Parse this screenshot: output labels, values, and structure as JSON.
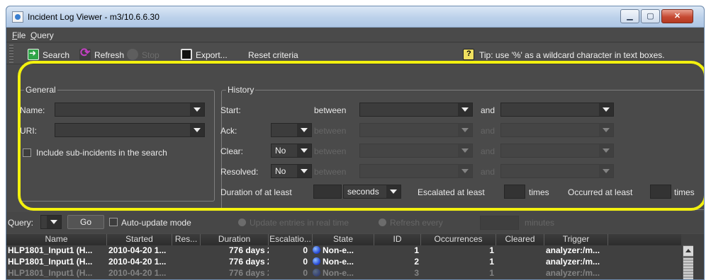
{
  "window": {
    "title": "Incident Log Viewer - m3/10.6.6.30",
    "minimize": "▁",
    "maximize": "▢",
    "close": "✕"
  },
  "menu": {
    "file": "File",
    "query": "Query"
  },
  "toolbar": {
    "search": "Search",
    "refresh": "Refresh",
    "stop": "Stop",
    "export": "Export...",
    "reset": "Reset criteria",
    "tip": "Tip: use '%' as a wildcard character in text boxes."
  },
  "general": {
    "title": "General",
    "name_label": "Name:",
    "uri_label": "URI:",
    "include_sub": "Include sub-incidents in the search"
  },
  "history": {
    "title": "History",
    "start_label": "Start:",
    "ack_label": "Ack:",
    "clear_label": "Clear:",
    "resolved_label": "Resolved:",
    "between": "between",
    "and": "and",
    "clear_value": "No",
    "resolved_value": "No",
    "duration_label": "Duration of at least",
    "duration_unit": "seconds",
    "escalated_label": "Escalated at least",
    "occurred_label": "Occurred at least",
    "times": "times"
  },
  "querybar": {
    "query_label": "Query:",
    "go": "Go",
    "auto_update": "Auto-update mode",
    "realtime": "Update entries in real time",
    "refresh_every": "Refresh every",
    "minutes": "minutes"
  },
  "table": {
    "columns": [
      "Name",
      "Started",
      "Res...",
      "Duration",
      "Escalatio...",
      "State",
      "ID",
      "Occurrences",
      "Cleared",
      "Trigger"
    ],
    "rows": [
      {
        "name": "HLP1801_Input1 (H...",
        "started": "2010-04-20 1...",
        "duration": "776 days 2...",
        "escalation": "0",
        "state": "Non-e...",
        "id": "1",
        "occurrences": "1",
        "trigger": "analyzer:/m..."
      },
      {
        "name": "HLP1801_Input1 (H...",
        "started": "2010-04-20 1...",
        "duration": "776 days 2...",
        "escalation": "0",
        "state": "Non-e...",
        "id": "2",
        "occurrences": "1",
        "trigger": "analyzer:/m..."
      },
      {
        "name": "HLP1801_Input1 (H...",
        "started": "2010-04-20 1...",
        "duration": "776 days 2...",
        "escalation": "0",
        "state": "Non-e...",
        "id": "3",
        "occurrences": "1",
        "trigger": "analyzer:/m..."
      }
    ]
  },
  "colors": {
    "highlight": "#f3f10f",
    "window_bg": "#4a4a4a",
    "state_dot": "#2040d0"
  }
}
